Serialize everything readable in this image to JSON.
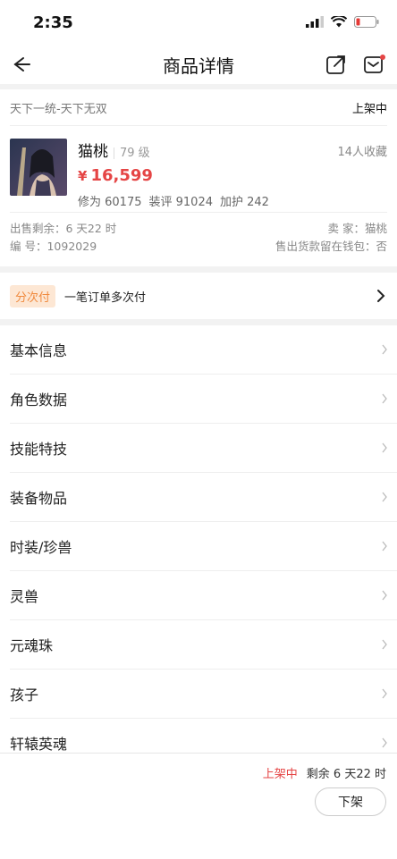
{
  "status_bar": {
    "time": "2:35"
  },
  "nav": {
    "title": "商品详情"
  },
  "listing": {
    "server": "天下一统-天下无双",
    "state": "上架中",
    "name": "猫桃",
    "level": "79 级",
    "favorites": "14人收藏",
    "price": "16,599",
    "currency": "¥",
    "stats": [
      "修为 60175",
      "装评 91024",
      "加护 242"
    ],
    "remaining_label": "出售剩余：6 天22 时",
    "seller_label": "卖 家：猫桃",
    "id_label": "编 号：1092029",
    "wallet_label": "售出货款留在钱包：否"
  },
  "installment": {
    "tag": "分次付",
    "text": "一笔订单多次付"
  },
  "menu": [
    {
      "label": "基本信息"
    },
    {
      "label": "角色数据"
    },
    {
      "label": "技能特技"
    },
    {
      "label": "装备物品"
    },
    {
      "label": "时装/珍兽"
    },
    {
      "label": "灵兽"
    },
    {
      "label": "元魂珠"
    },
    {
      "label": "孩子"
    },
    {
      "label": "轩辕英魂"
    }
  ],
  "footer": {
    "state": "上架中",
    "remaining": "剩余 6 天22 时",
    "button": "下架"
  },
  "colors": {
    "accent": "#e54545",
    "tag_bg": "#fde7d4",
    "tag_text": "#f08a3e"
  }
}
